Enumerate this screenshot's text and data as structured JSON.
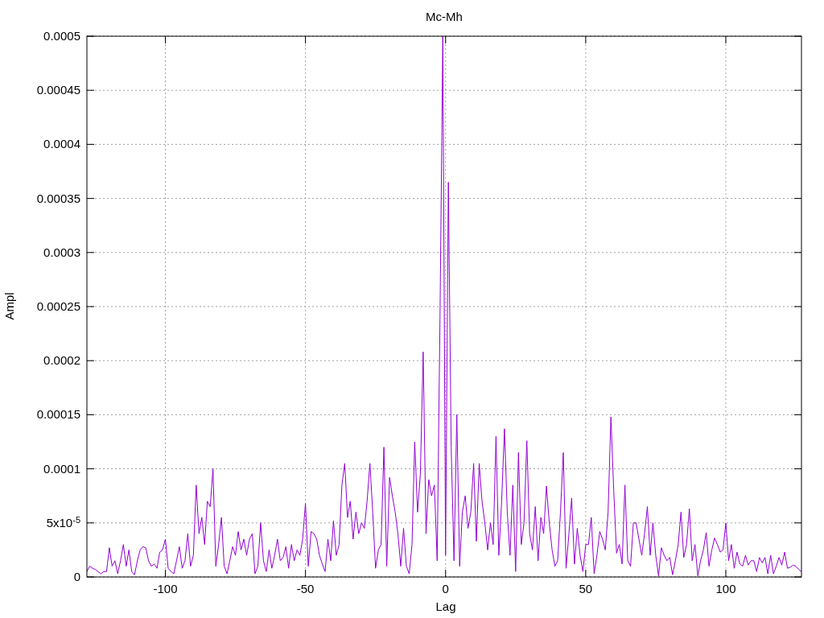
{
  "chart_data": {
    "type": "line",
    "grid": true,
    "title": "Mc-Mh",
    "xlabel": "Lag",
    "ylabel": "Ampl",
    "xlim": [
      -128,
      127
    ],
    "ylim": [
      0,
      0.0005
    ],
    "xticks": [
      {
        "value": -100,
        "label": "-100"
      },
      {
        "value": -50,
        "label": "-50"
      },
      {
        "value": 0,
        "label": "0"
      },
      {
        "value": 50,
        "label": "50"
      },
      {
        "value": 100,
        "label": "100"
      }
    ],
    "yticks": [
      {
        "value": 0,
        "label": "0"
      },
      {
        "value": 5e-05,
        "label": "5x10$^{-5}$"
      },
      {
        "value": 0.0001,
        "label": "0.0001"
      },
      {
        "value": 0.00015,
        "label": "0.00015"
      },
      {
        "value": 0.0002,
        "label": "0.0002"
      },
      {
        "value": 0.00025,
        "label": "0.00025"
      },
      {
        "value": 0.0003,
        "label": "0.0003"
      },
      {
        "value": 0.00035,
        "label": "0.00035"
      },
      {
        "value": 0.0004,
        "label": "0.0004"
      },
      {
        "value": 0.00045,
        "label": "0.00045"
      },
      {
        "value": 0.0005,
        "label": "0.0005"
      }
    ],
    "x": [
      -128,
      -127,
      -126,
      -125,
      -124,
      -123,
      -122,
      -121,
      -120,
      -119,
      -118,
      -117,
      -116,
      -115,
      -114,
      -113,
      -112,
      -111,
      -110,
      -109,
      -108,
      -107,
      -106,
      -105,
      -104,
      -103,
      -102,
      -101,
      -100,
      -99,
      -98,
      -97,
      -96,
      -95,
      -94,
      -93,
      -92,
      -91,
      -90,
      -89,
      -88,
      -87,
      -86,
      -85,
      -84,
      -83,
      -82,
      -81,
      -80,
      -79,
      -78,
      -77,
      -76,
      -75,
      -74,
      -73,
      -72,
      -71,
      -70,
      -69,
      -68,
      -67,
      -66,
      -65,
      -64,
      -63,
      -62,
      -61,
      -60,
      -59,
      -58,
      -57,
      -56,
      -55,
      -54,
      -53,
      -52,
      -51,
      -50,
      -49,
      -48,
      -47,
      -46,
      -45,
      -44,
      -43,
      -42,
      -41,
      -40,
      -39,
      -38,
      -37,
      -36,
      -35,
      -34,
      -33,
      -32,
      -31,
      -30,
      -29,
      -28,
      -27,
      -26,
      -25,
      -24,
      -23,
      -22,
      -21,
      -20,
      -19,
      -18,
      -17,
      -16,
      -15,
      -14,
      -13,
      -12,
      -11,
      -10,
      -9,
      -8,
      -7,
      -6,
      -5,
      -4,
      -3,
      -2,
      -1,
      0,
      1,
      2,
      3,
      4,
      5,
      6,
      7,
      8,
      9,
      10,
      11,
      12,
      13,
      14,
      15,
      16,
      17,
      18,
      19,
      20,
      21,
      22,
      23,
      24,
      25,
      26,
      27,
      28,
      29,
      30,
      31,
      32,
      33,
      34,
      35,
      36,
      37,
      38,
      39,
      40,
      41,
      42,
      43,
      44,
      45,
      46,
      47,
      48,
      49,
      50,
      51,
      52,
      53,
      54,
      55,
      56,
      57,
      58,
      59,
      60,
      61,
      62,
      63,
      64,
      65,
      66,
      67,
      68,
      69,
      70,
      71,
      72,
      73,
      74,
      75,
      76,
      77,
      78,
      79,
      80,
      81,
      82,
      83,
      84,
      85,
      86,
      87,
      88,
      89,
      90,
      91,
      92,
      93,
      94,
      95,
      96,
      97,
      98,
      99,
      100,
      101,
      102,
      103,
      104,
      105,
      106,
      107,
      108,
      109,
      110,
      111,
      112,
      113,
      114,
      115,
      116,
      117,
      118,
      119,
      120,
      121,
      122,
      123,
      124,
      125,
      126,
      127
    ],
    "series": [
      {
        "color": "#9400d3",
        "values": [
          5e-06,
          1e-05,
          8e-06,
          7e-06,
          5e-06,
          3e-06,
          5e-06,
          5e-06,
          2.7e-05,
          1e-05,
          1.5e-05,
          3e-06,
          1.5e-05,
          3e-05,
          1e-05,
          2.5e-05,
          5e-06,
          2e-06,
          1.5e-05,
          2.5e-05,
          2.8e-05,
          2.7e-05,
          1.5e-05,
          1e-05,
          1.2e-05,
          8e-06,
          2.3e-05,
          2.5e-05,
          3.5e-05,
          8e-06,
          5e-06,
          3e-06,
          1.5e-05,
          2.8e-05,
          8e-06,
          1.5e-05,
          4e-05,
          1e-05,
          2e-05,
          8.5e-05,
          4e-05,
          5.5e-05,
          3e-05,
          7e-05,
          6.5e-05,
          0.0001,
          1e-05,
          3e-05,
          5.5e-05,
          1e-05,
          3e-06,
          1.5e-05,
          2.8e-05,
          2e-05,
          4.2e-05,
          2.5e-05,
          3.5e-05,
          2e-05,
          3.5e-05,
          4e-05,
          3e-06,
          1e-05,
          5e-05,
          1.5e-05,
          5e-06,
          2.5e-05,
          8e-06,
          2e-05,
          3.5e-05,
          1.5e-05,
          1.8e-05,
          2.8e-05,
          8e-06,
          3e-05,
          1.5e-05,
          2.5e-05,
          2e-05,
          3.5e-05,
          6.8e-05,
          1e-05,
          4.2e-05,
          4e-05,
          3.5e-05,
          2e-05,
          1.2e-05,
          5e-06,
          3.5e-05,
          1.5e-05,
          5.2e-05,
          2e-05,
          3e-05,
          8.5e-05,
          0.000105,
          5.5e-05,
          7e-05,
          3.5e-05,
          6e-05,
          4e-05,
          5e-05,
          4.5e-05,
          7e-05,
          0.000105,
          6e-05,
          8e-06,
          2.5e-05,
          3e-05,
          0.00012,
          1e-05,
          9.2e-05,
          7.5e-05,
          6e-05,
          4e-05,
          1e-05,
          4.5e-05,
          1e-05,
          3e-06,
          3e-05,
          0.000125,
          6e-05,
          9.5e-05,
          0.000208,
          4e-05,
          9e-05,
          7.5e-05,
          8.5e-05,
          1.5e-05,
          0.00024,
          0.0005,
          2e-05,
          0.000365,
          0.00012,
          1.5e-05,
          0.00015,
          1e-05,
          6e-05,
          7.5e-05,
          4.5e-05,
          6e-05,
          0.000105,
          3.3e-05,
          0.000105,
          7e-05,
          5e-05,
          2.5e-05,
          5e-05,
          3e-05,
          0.00013,
          2e-05,
          7e-05,
          0.000137,
          6e-05,
          2e-05,
          8.5e-05,
          5e-06,
          0.000115,
          3e-05,
          5e-05,
          0.000126,
          4e-05,
          2.5e-05,
          6.5e-05,
          1.5e-05,
          5.5e-05,
          4e-05,
          8.4e-05,
          5e-05,
          2.5e-05,
          1e-05,
          1.5e-05,
          6e-05,
          0.000115,
          8e-06,
          4e-05,
          7.3e-05,
          1.2e-05,
          4.5e-05,
          2e-05,
          5e-06,
          3e-05,
          3e-05,
          5.5e-05,
          3e-06,
          2e-05,
          4.2e-05,
          3.5e-05,
          2.5e-05,
          6e-05,
          0.000148,
          8e-05,
          2.2e-05,
          3e-05,
          1.2e-05,
          8.5e-05,
          1.5e-05,
          1e-05,
          5e-05,
          5e-05,
          3.5e-05,
          2e-05,
          4e-05,
          6.5e-05,
          2e-05,
          5e-05,
          2e-05,
          1e-06,
          2.7e-05,
          2e-05,
          1.5e-05,
          1.8e-05,
          2e-06,
          1.5e-05,
          3e-05,
          6e-05,
          1.8e-05,
          3e-05,
          6.3e-05,
          1.5e-05,
          3e-05,
          1e-06,
          1.5e-05,
          2.5e-05,
          4.1e-05,
          1e-05,
          2.5e-05,
          3.6e-05,
          3e-05,
          2.3e-05,
          2.5e-05,
          5e-05,
          1.5e-05,
          3e-05,
          8e-06,
          2.3e-05,
          1.2e-05,
          1e-05,
          2e-05,
          1.1e-05,
          1.5e-05,
          1.5e-05,
          5e-06,
          1.8e-05,
          1.3e-05,
          1.8e-05,
          3e-06,
          2e-05,
          3e-06,
          1e-05,
          1.8e-05,
          1.1e-05,
          2.3e-05,
          8e-06,
          9e-06,
          1.1e-05,
          1e-05,
          7e-06,
          5e-06
        ]
      }
    ]
  }
}
